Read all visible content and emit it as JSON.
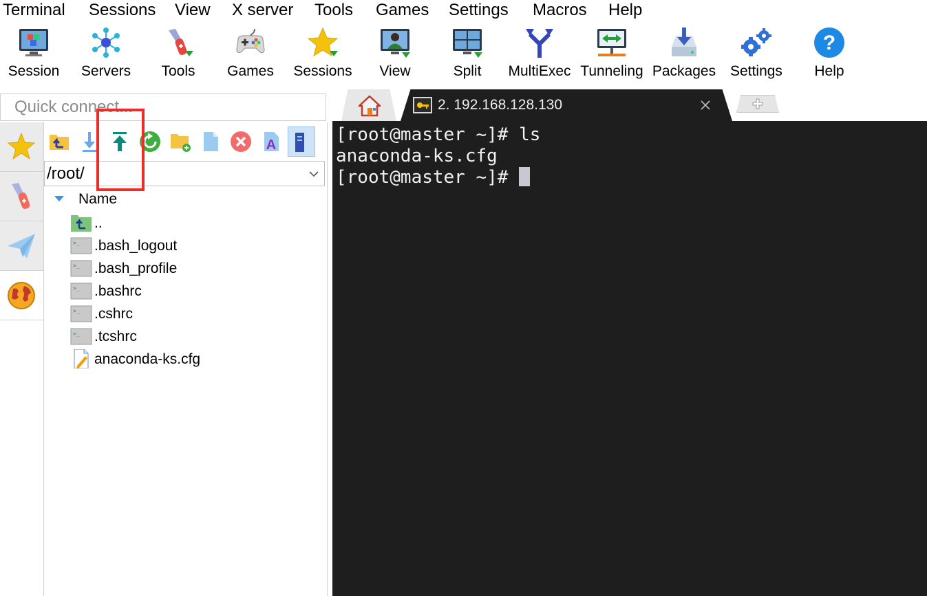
{
  "menu": [
    "Terminal",
    "Sessions",
    "View",
    "X server",
    "Tools",
    "Games",
    "Settings",
    "Macros",
    "Help"
  ],
  "toolbar": [
    {
      "label": "Session",
      "icon": "session-monitor-icon"
    },
    {
      "label": "Servers",
      "icon": "servers-network-icon"
    },
    {
      "label": "Tools",
      "icon": "tools-knife-icon"
    },
    {
      "label": "Games",
      "icon": "gamepad-icon"
    },
    {
      "label": "Sessions",
      "icon": "star-icon"
    },
    {
      "label": "View",
      "icon": "view-monitor-user-icon"
    },
    {
      "label": "Split",
      "icon": "split-screen-icon"
    },
    {
      "label": "MultiExec",
      "icon": "multiexec-fork-icon"
    },
    {
      "label": "Tunneling",
      "icon": "tunneling-icon"
    },
    {
      "label": "Packages",
      "icon": "packages-icon"
    },
    {
      "label": "Settings",
      "icon": "settings-gears-icon"
    },
    {
      "label": "Help",
      "icon": "help-question-icon"
    }
  ],
  "quick_connect": {
    "placeholder": "Quick connect..."
  },
  "side_tabs": [
    "sessions-star-icon",
    "tools-knife-icon",
    "macros-paperplane-icon",
    "sftp-globe-icon"
  ],
  "sftp": {
    "toolbar_icons": [
      "parent-folder-icon",
      "download-icon",
      "upload-icon",
      "refresh-icon",
      "new-folder-icon",
      "new-file-icon",
      "delete-icon",
      "rename-icon",
      "follow-terminal-icon"
    ],
    "path": "/root/",
    "column_header": "Name",
    "files": [
      {
        "name": "..",
        "icon": "parent-folder-icon"
      },
      {
        "name": ".bash_logout",
        "icon": "shell-script-icon"
      },
      {
        "name": ".bash_profile",
        "icon": "shell-script-icon"
      },
      {
        "name": ".bashrc",
        "icon": "shell-script-icon"
      },
      {
        "name": ".cshrc",
        "icon": "shell-script-icon"
      },
      {
        "name": ".tcshrc",
        "icon": "shell-script-icon"
      },
      {
        "name": "anaconda-ks.cfg",
        "icon": "text-file-icon"
      }
    ]
  },
  "tabs": {
    "home_icon": "home-icon",
    "session_title": "2. 192.168.128.130",
    "new_tab_icon": "plus-icon"
  },
  "terminal": {
    "lines": [
      "[root@master ~]# ls",
      "anaconda-ks.cfg",
      "[root@master ~]# "
    ]
  },
  "colors": {
    "terminal_bg": "#1e1e1e",
    "highlight_box": "#ee2b24",
    "accent_blue": "#3d8fe0"
  }
}
